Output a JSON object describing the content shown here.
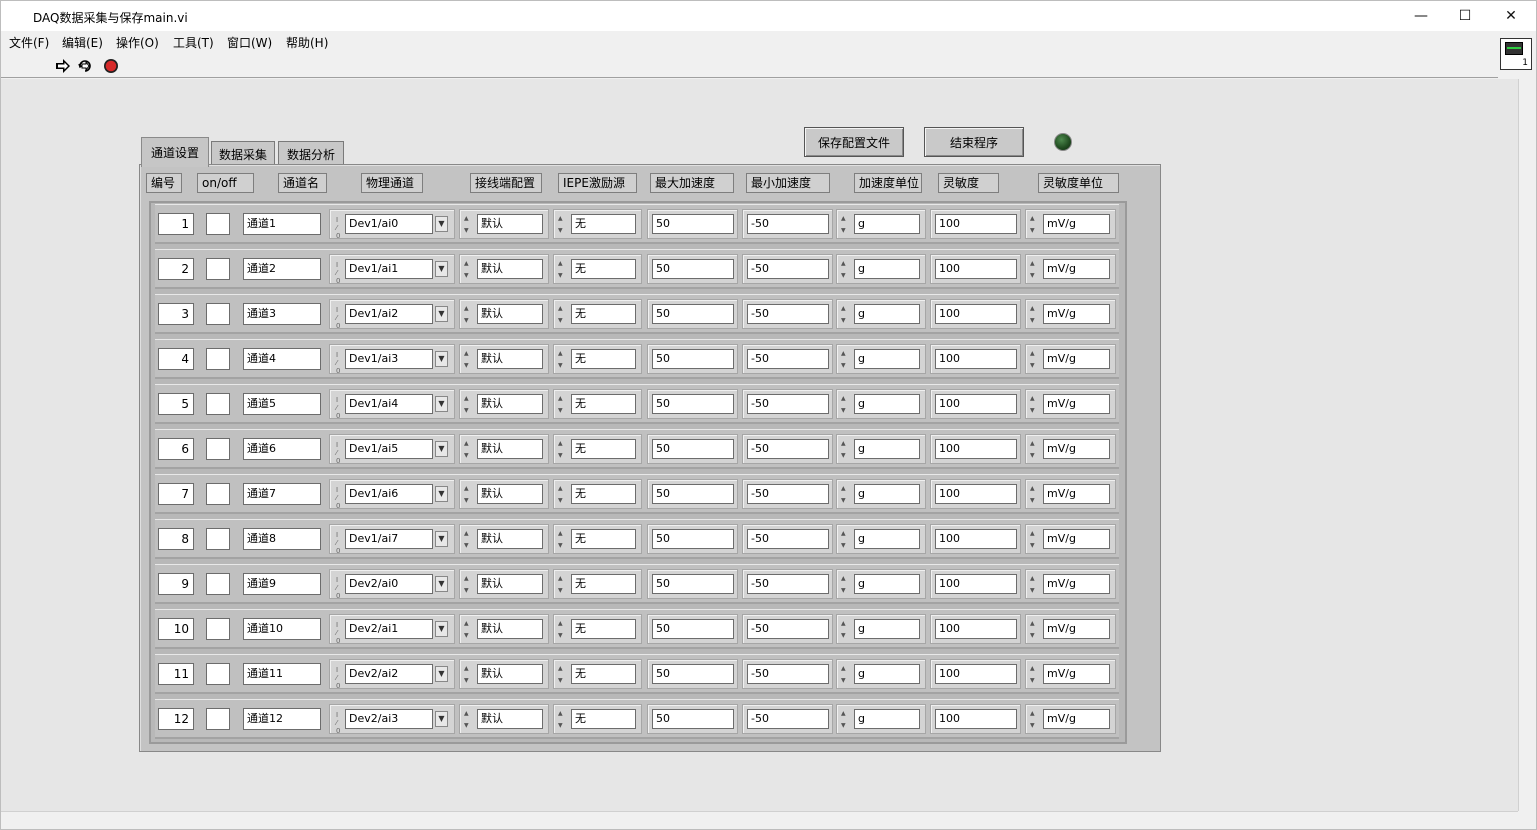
{
  "window": {
    "title": "DAQ数据采集与保存main.vi",
    "minimize": "—",
    "maximize": "☐",
    "close": "✕"
  },
  "menu": [
    "文件(F)",
    "编辑(E)",
    "操作(O)",
    "工具(T)",
    "窗口(W)",
    "帮助(H)"
  ],
  "toolbar": {
    "run_icon": "run-arrow-icon",
    "run_continuous_icon": "run-continuously-icon",
    "abort_icon": "abort-stop-icon"
  },
  "vi_icon": {
    "number": "1"
  },
  "tabs": [
    {
      "label": "通道设置",
      "active": true
    },
    {
      "label": "数据采集",
      "active": false
    },
    {
      "label": "数据分析",
      "active": false
    }
  ],
  "buttons": {
    "save_config": "保存配置文件",
    "end_program": "结束程序"
  },
  "led": {
    "color": "#2f5e2f",
    "state": "off"
  },
  "columns": [
    "编号",
    "on/off",
    "通道名",
    "物理通道",
    "接线端配置",
    "IEPE激励源",
    "最大加速度",
    "最小加速度",
    "加速度单位",
    "灵敏度",
    "灵敏度单位"
  ],
  "rows": [
    {
      "id": "1",
      "name": "通道1",
      "phys": "Dev1/ai0",
      "term": "默认",
      "iepe": "无",
      "max": "50",
      "min": "-50",
      "unit": "g",
      "sens": "100",
      "sens_unit": "mV/g"
    },
    {
      "id": "2",
      "name": "通道2",
      "phys": "Dev1/ai1",
      "term": "默认",
      "iepe": "无",
      "max": "50",
      "min": "-50",
      "unit": "g",
      "sens": "100",
      "sens_unit": "mV/g"
    },
    {
      "id": "3",
      "name": "通道3",
      "phys": "Dev1/ai2",
      "term": "默认",
      "iepe": "无",
      "max": "50",
      "min": "-50",
      "unit": "g",
      "sens": "100",
      "sens_unit": "mV/g"
    },
    {
      "id": "4",
      "name": "通道4",
      "phys": "Dev1/ai3",
      "term": "默认",
      "iepe": "无",
      "max": "50",
      "min": "-50",
      "unit": "g",
      "sens": "100",
      "sens_unit": "mV/g"
    },
    {
      "id": "5",
      "name": "通道5",
      "phys": "Dev1/ai4",
      "term": "默认",
      "iepe": "无",
      "max": "50",
      "min": "-50",
      "unit": "g",
      "sens": "100",
      "sens_unit": "mV/g"
    },
    {
      "id": "6",
      "name": "通道6",
      "phys": "Dev1/ai5",
      "term": "默认",
      "iepe": "无",
      "max": "50",
      "min": "-50",
      "unit": "g",
      "sens": "100",
      "sens_unit": "mV/g"
    },
    {
      "id": "7",
      "name": "通道7",
      "phys": "Dev1/ai6",
      "term": "默认",
      "iepe": "无",
      "max": "50",
      "min": "-50",
      "unit": "g",
      "sens": "100",
      "sens_unit": "mV/g"
    },
    {
      "id": "8",
      "name": "通道8",
      "phys": "Dev1/ai7",
      "term": "默认",
      "iepe": "无",
      "max": "50",
      "min": "-50",
      "unit": "g",
      "sens": "100",
      "sens_unit": "mV/g"
    },
    {
      "id": "9",
      "name": "通道9",
      "phys": "Dev2/ai0",
      "term": "默认",
      "iepe": "无",
      "max": "50",
      "min": "-50",
      "unit": "g",
      "sens": "100",
      "sens_unit": "mV/g"
    },
    {
      "id": "10",
      "name": "通道10",
      "phys": "Dev2/ai1",
      "term": "默认",
      "iepe": "无",
      "max": "50",
      "min": "-50",
      "unit": "g",
      "sens": "100",
      "sens_unit": "mV/g"
    },
    {
      "id": "11",
      "name": "通道11",
      "phys": "Dev2/ai2",
      "term": "默认",
      "iepe": "无",
      "max": "50",
      "min": "-50",
      "unit": "g",
      "sens": "100",
      "sens_unit": "mV/g"
    },
    {
      "id": "12",
      "name": "通道12",
      "phys": "Dev2/ai3",
      "term": "默认",
      "iepe": "无",
      "max": "50",
      "min": "-50",
      "unit": "g",
      "sens": "100",
      "sens_unit": "mV/g"
    }
  ]
}
